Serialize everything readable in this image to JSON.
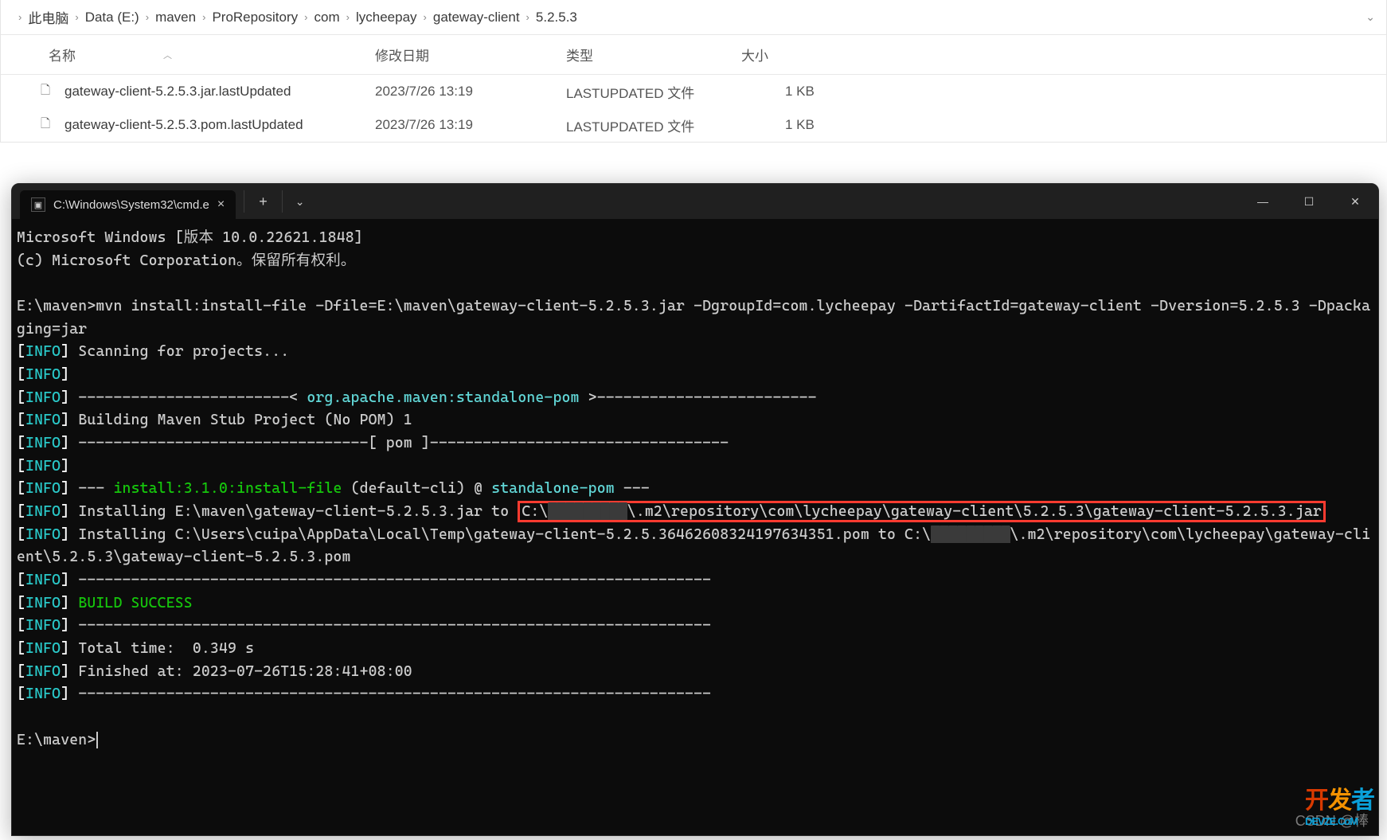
{
  "explorer": {
    "breadcrumb": [
      "此电脑",
      "Data (E:)",
      "maven",
      "ProRepository",
      "com",
      "lycheepay",
      "gateway-client",
      "5.2.5.3"
    ],
    "columns": {
      "name": "名称",
      "date": "修改日期",
      "type": "类型",
      "size": "大小"
    },
    "rows": [
      {
        "name": "gateway-client-5.2.5.3.jar.lastUpdated",
        "date": "2023/7/26 13:19",
        "type": "LASTUPDATED 文件",
        "size": "1 KB"
      },
      {
        "name": "gateway-client-5.2.5.3.pom.lastUpdated",
        "date": "2023/7/26 13:19",
        "type": "LASTUPDATED 文件",
        "size": "1 KB"
      }
    ]
  },
  "terminal": {
    "tab_title": "C:\\Windows\\System32\\cmd.e",
    "header_line_1": "Microsoft Windows [版本 10.0.22621.1848]",
    "header_line_2": "(c) Microsoft Corporation。保留所有权利。",
    "prompt1": "E:\\maven>",
    "cmd": "mvn install:install-file -Dfile=E:\\maven\\gateway-client-5.2.5.3.jar -DgroupId=com.lycheepay -DartifactId=gateway-client -Dversion=5.2.5.3 -Dpackaging=jar",
    "scan": "Scanning for projects...",
    "dash_open": "------------------------< ",
    "pom_id": "org.apache.maven:standalone-pom",
    "dash_close": " >-------------------------",
    "building": "Building Maven Stub Project (No POM) 1",
    "pom_sep": "---------------------------------[ pom ]----------------------------------",
    "goal_pre": "--- ",
    "goal_green": "install:3.1.0:install-file",
    "goal_mid": " (default-cli) @ ",
    "goal_cyan": "standalone-pom",
    "goal_post": " ---",
    "install1_pre": "Installing E:\\maven\\gateway-client-5.2.5.3.jar to ",
    "install1_box_pre": "C:\\",
    "install1_box_mid_redacted": "█████████",
    "install1_box_post": "\\.m2\\repository\\com\\lycheepay\\gateway-client\\5.2.5.3\\gateway-client-5.2.5.3.jar",
    "install2_pre": "Installing C:\\Users\\cuipa\\AppData\\Local\\Temp\\gateway-client-5.2.5.36462608324197634351.pom to C:\\",
    "install2_red": "█████████",
    "install2_post": "\\.m2\\repository\\com\\lycheepay\\gateway-client\\5.2.5.3\\gateway-client-5.2.5.3.pom",
    "sep_long": "------------------------------------------------------------------------",
    "build_success": "BUILD SUCCESS",
    "total_time": "Total time:  0.349 s",
    "finished_at": "Finished at: 2023-07-26T15:28:41+08:00",
    "prompt2": "E:\\maven>",
    "info_label": "INFO"
  },
  "watermark": "CSDN @棒",
  "logo": {
    "p1": "开",
    "p2": "发",
    "p3": "者",
    "sub": "DEVZE.CoM"
  }
}
